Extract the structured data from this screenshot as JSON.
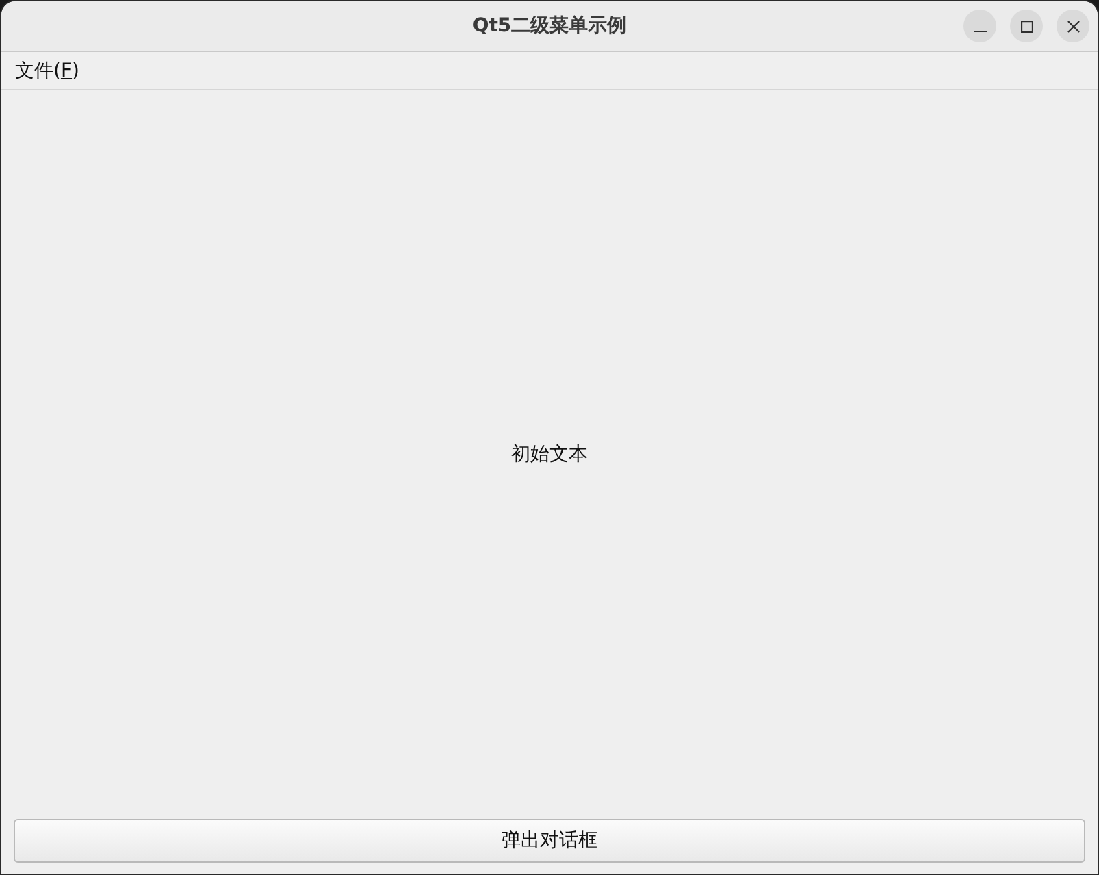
{
  "window": {
    "title": "Qt5二级菜单示例",
    "controls": [
      {
        "kind": "minimize"
      },
      {
        "kind": "maximize"
      },
      {
        "kind": "close"
      }
    ]
  },
  "menu_bar": [
    {
      "label_before": "文件(",
      "mnemonic": "F",
      "label_after": ")"
    }
  ],
  "central": {
    "label": "初始文本"
  },
  "button": {
    "label": "弹出对话框"
  }
}
